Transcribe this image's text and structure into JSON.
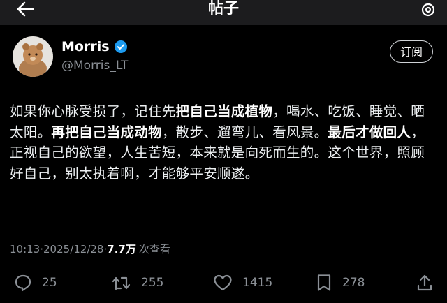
{
  "header": {
    "title": "帖子",
    "back_icon": "arrow-left-icon",
    "settings_icon": "settings-icon"
  },
  "author": {
    "name": "Morris",
    "handle": "@Morris_LT",
    "verified": true
  },
  "subscribe_label": "订阅",
  "post": {
    "segments": [
      {
        "text": "如果你心脉受损了，记住先",
        "bold": false
      },
      {
        "text": "把自己当成植物",
        "bold": true
      },
      {
        "text": "，喝水、吃饭、睡觉、晒太阳。",
        "bold": false
      },
      {
        "text": "再把自己当成动物",
        "bold": true
      },
      {
        "text": "，散步、遛弯儿、看风景。",
        "bold": false
      },
      {
        "text": "最后才做回人",
        "bold": true
      },
      {
        "text": "，正视自己的欲望，人生苦短，本来就是向死而生的。这个世界，照顾好自己，别太执着啊，才能够平安顺遂。",
        "bold": false
      }
    ]
  },
  "meta": {
    "time": "10:13",
    "sep1": " · ",
    "date": "2025/12/28",
    "sep2": " · ",
    "views_value": "7.7万",
    "views_label": "次查看"
  },
  "actions": {
    "replies": "25",
    "reposts": "255",
    "likes": "1415",
    "bookmarks": "278"
  },
  "colors": {
    "background": "#000000",
    "topbar": "#1c1c1e",
    "verified": "#1d9bf0",
    "muted": "#8b9096"
  }
}
